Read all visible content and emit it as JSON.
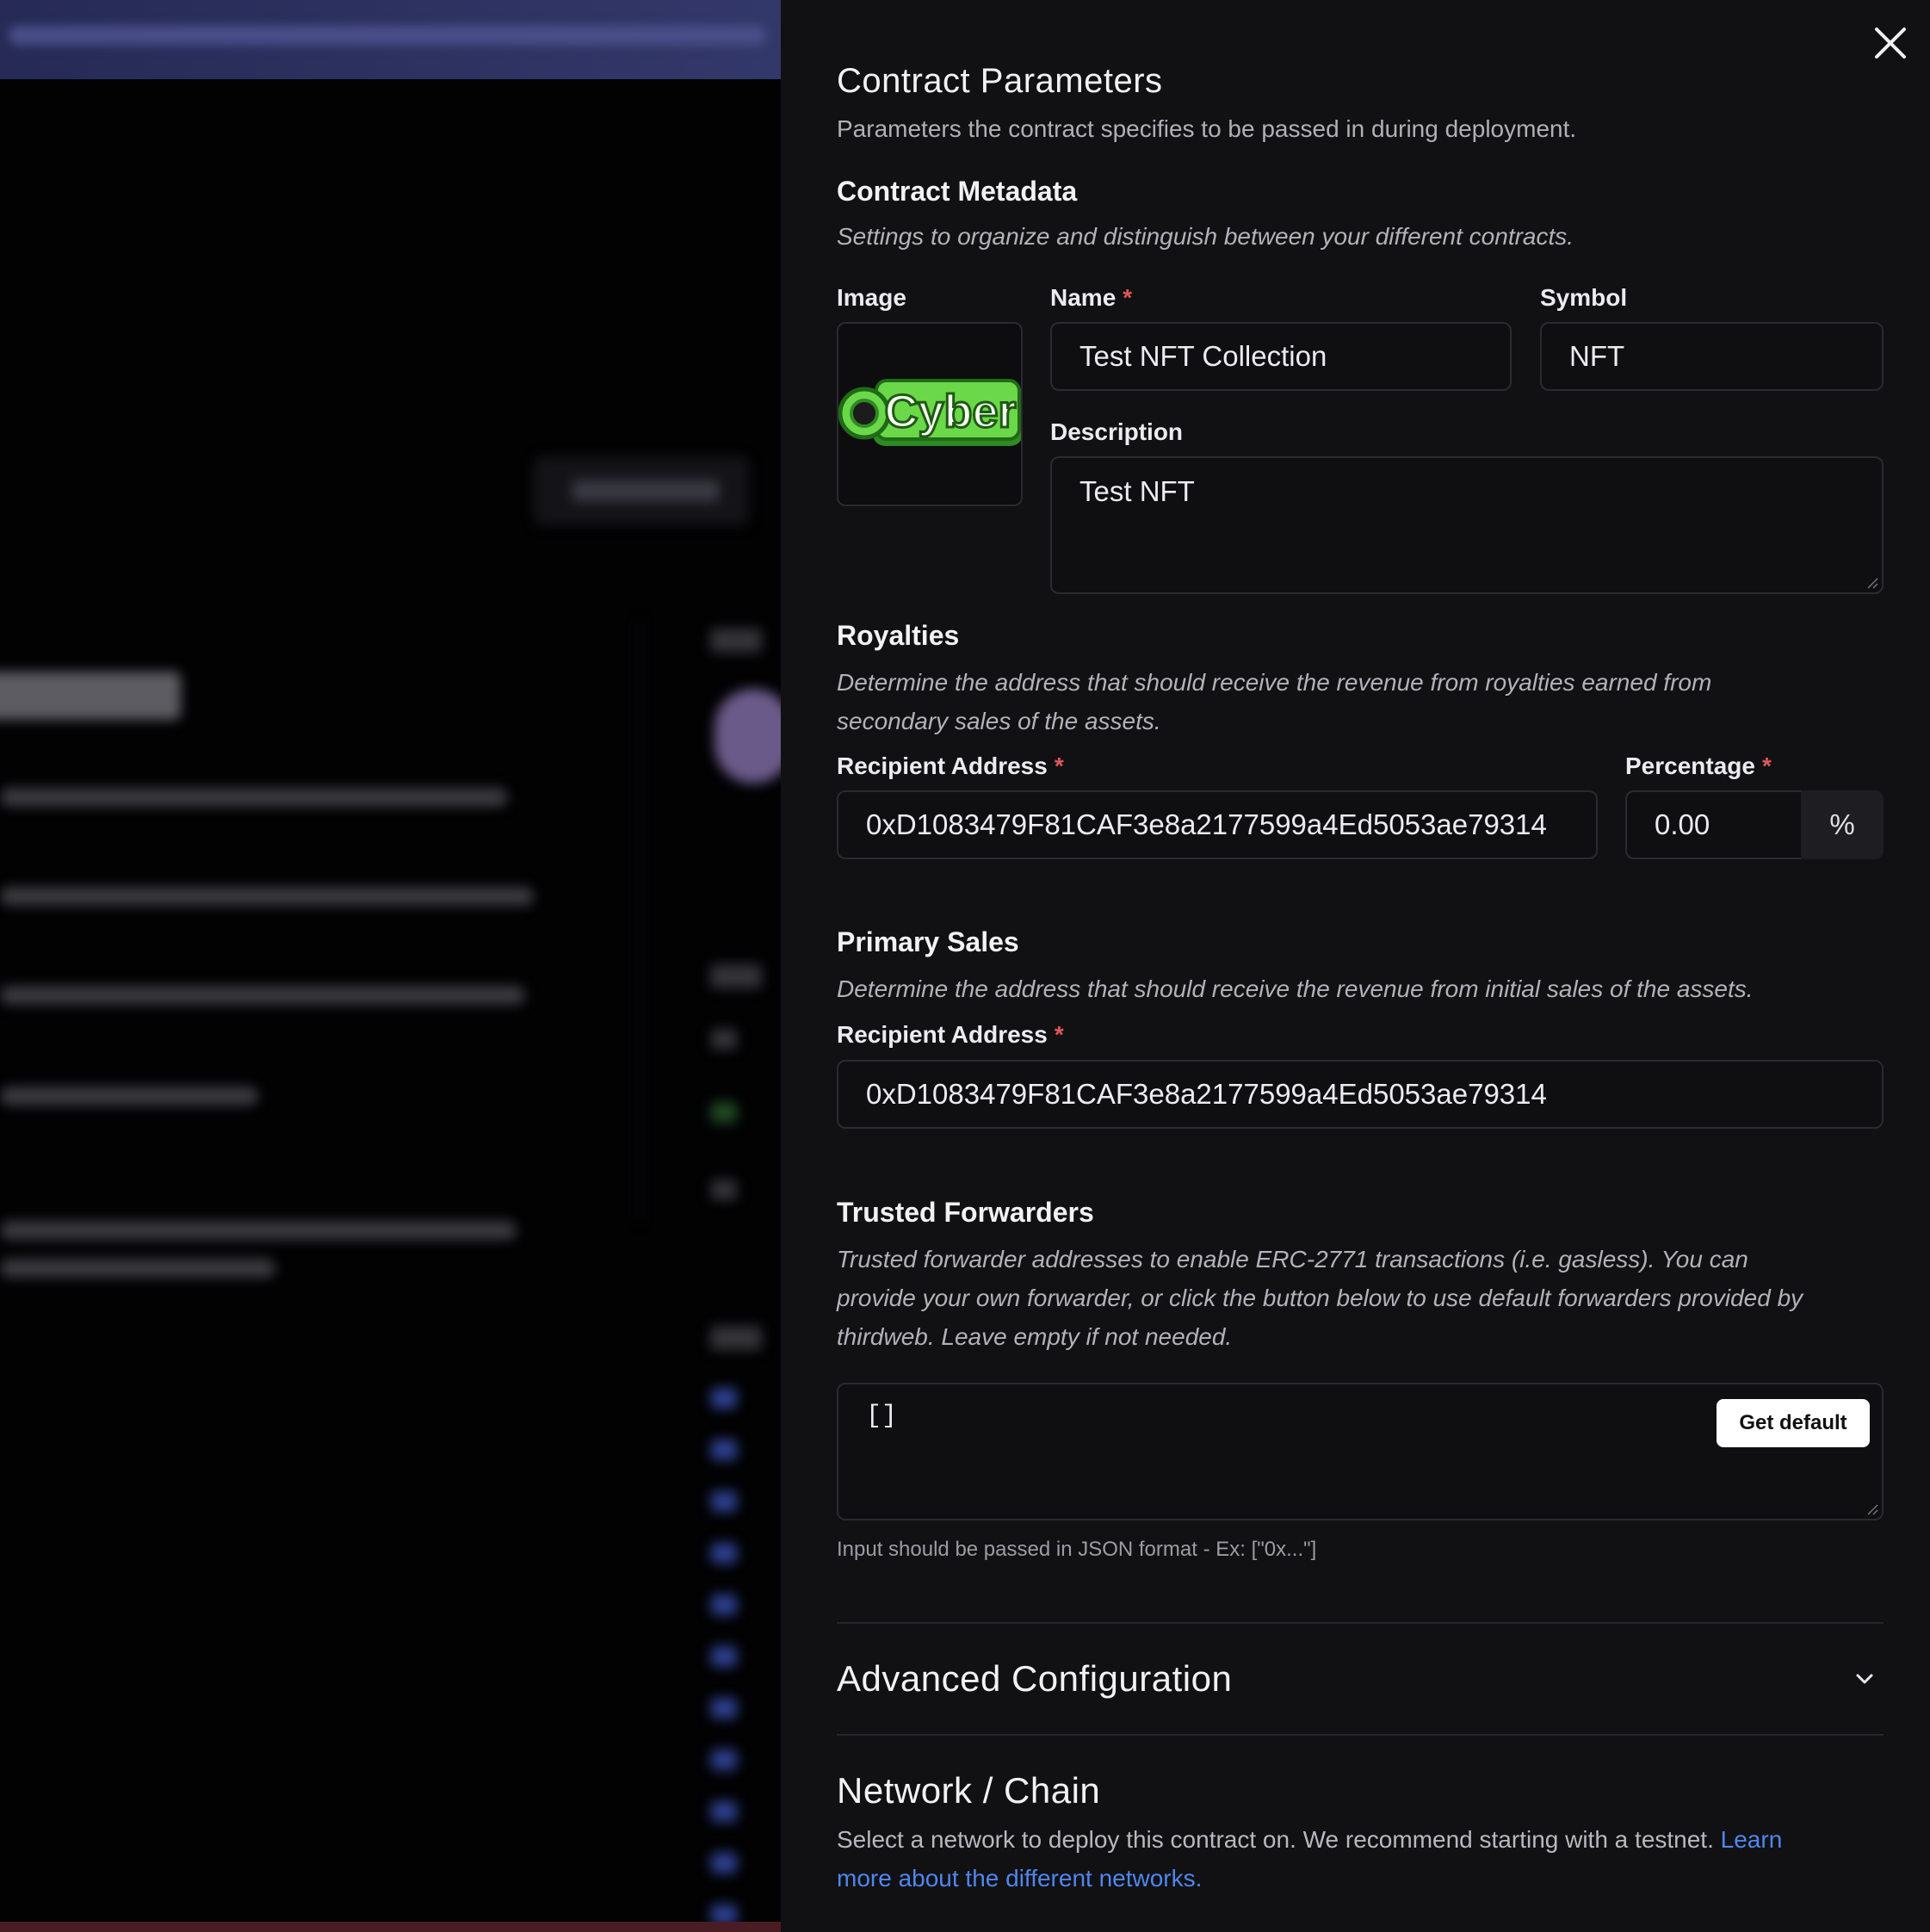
{
  "drawer": {
    "title": "Contract Parameters",
    "subtitle": "Parameters the contract specifies to be passed in during deployment."
  },
  "metadata": {
    "heading": "Contract Metadata",
    "description": "Settings to organize and distinguish between your different contracts.",
    "image_label": "Image",
    "image_logo_text": "Cyber",
    "name_label": "Name",
    "name_value": "Test NFT Collection",
    "symbol_label": "Symbol",
    "symbol_value": "NFT",
    "description_label": "Description",
    "description_value": "Test NFT"
  },
  "royalties": {
    "heading": "Royalties",
    "description_line1": "Determine the address that should receive the revenue from royalties earned from",
    "description_line2": "secondary sales of the assets.",
    "recipient_label": "Recipient Address",
    "recipient_value": "0xD1083479F81CAF3e8a2177599a4Ed5053ae79314",
    "percentage_label": "Percentage",
    "percentage_value": "0.00",
    "percentage_suffix": "%"
  },
  "primary_sales": {
    "heading": "Primary Sales",
    "description": "Determine the address that should receive the revenue from initial sales of the assets.",
    "recipient_label": "Recipient Address",
    "recipient_value": "0xD1083479F81CAF3e8a2177599a4Ed5053ae79314"
  },
  "trusted_forwarders": {
    "heading": "Trusted Forwarders",
    "description_line1": "Trusted forwarder addresses to enable ERC-2771 transactions (i.e. gasless). You can",
    "description_line2": "provide your own forwarder, or click the button below to use default forwarders provided by",
    "description_line3": "thirdweb. Leave empty if not needed.",
    "value": "[]",
    "get_default_label": "Get default",
    "help_text": "Input should be passed in JSON format - Ex: [\"0x...\"]"
  },
  "advanced": {
    "heading": "Advanced Configuration"
  },
  "network": {
    "heading": "Network / Chain",
    "description": "Select a network to deploy this contract on. We recommend starting with a testnet. ",
    "link_part1": "Learn",
    "link_part2": "more about the different networks."
  },
  "required_marker": "*",
  "colors": {
    "drawer_bg": "#111113",
    "required": "#e0575b",
    "link": "#4f86ee",
    "logo_green": "#4cc63a"
  }
}
